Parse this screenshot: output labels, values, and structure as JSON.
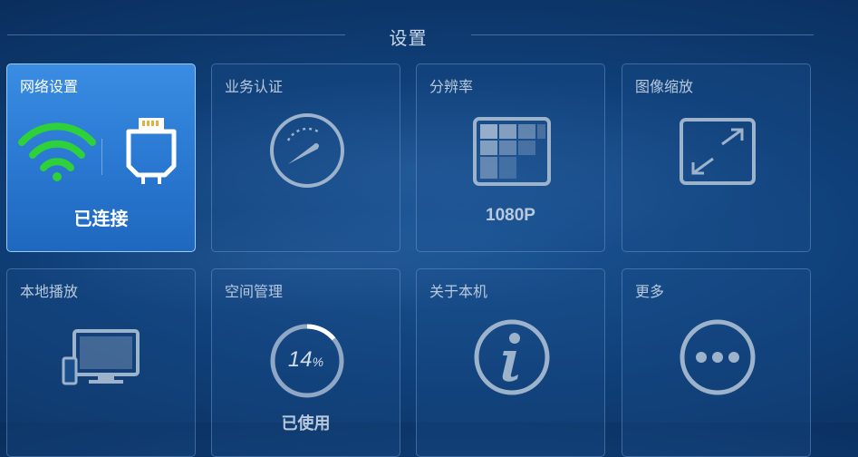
{
  "header": {
    "title": "设置"
  },
  "tiles": [
    {
      "label": "网络设置",
      "status": "已连接"
    },
    {
      "label": "业务认证"
    },
    {
      "label": "分辨率",
      "value": "1080P"
    },
    {
      "label": "图像缩放"
    },
    {
      "label": "本地播放"
    },
    {
      "label": "空间管理",
      "percent_number": "14",
      "percent_sign": "%",
      "status": "已使用",
      "usage_fraction": 0.14
    },
    {
      "label": "关于本机"
    },
    {
      "label": "更多"
    }
  ],
  "colors": {
    "background": "#0f3f78",
    "active_tile": "#2a79d2",
    "wifi_green": "#2fd13a",
    "icon_line": "#9db3cc"
  }
}
